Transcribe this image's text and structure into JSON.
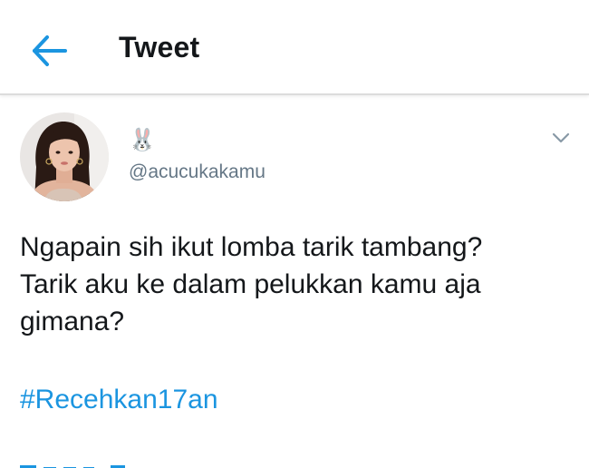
{
  "header": {
    "title": "Tweet",
    "back_icon": "arrow-left-icon"
  },
  "author": {
    "display_name_emoji": "🐰",
    "handle": "@acucukakamu",
    "avatar_icon": "avatar-photo"
  },
  "tweet": {
    "lines": [
      "Ngapain sih ikut lomba tarik tambang?",
      "Tarik aku ke dalam pelukkan kamu aja",
      "gimana?"
    ],
    "hashtag": "#Recehkan17an"
  },
  "colors": {
    "accent": "#1b95e0",
    "text": "#14171a",
    "secondary": "#657786"
  }
}
